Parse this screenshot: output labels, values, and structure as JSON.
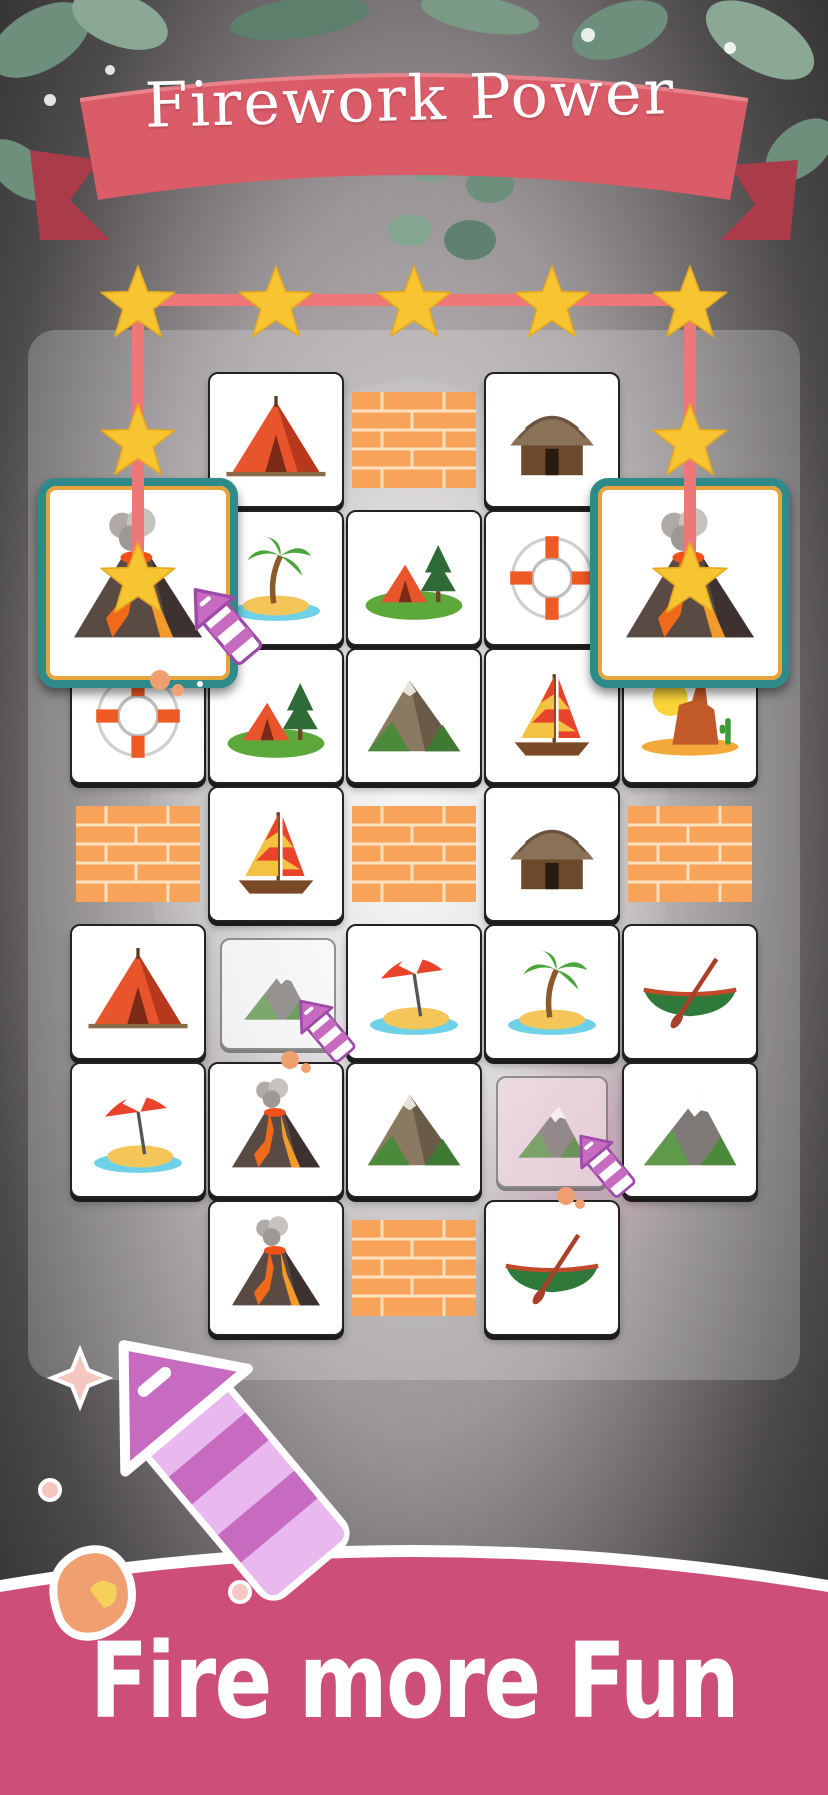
{
  "title": "Firework Power",
  "tagline": "Fire more Fun",
  "colors": {
    "banner": "#d95c68",
    "banner_dark": "#a93c48",
    "path_line": "#ee7777",
    "star": "#f7c531",
    "bottom_band": "#cd4f78",
    "rocket_pink": "#c66bbf",
    "rocket_light": "#e8b8ee"
  },
  "board": {
    "highlighted_pair": [
      "volcano",
      "volcano"
    ],
    "star_path_count": 9,
    "tiles": [
      {
        "row": 1,
        "col": 2,
        "icon": "tent-icon"
      },
      {
        "row": 1,
        "col": 3,
        "icon": "brick-icon"
      },
      {
        "row": 1,
        "col": 4,
        "icon": "hut-icon"
      },
      {
        "row": 2,
        "col": 2,
        "icon": "palm-island-icon"
      },
      {
        "row": 2,
        "col": 3,
        "icon": "camping-icon"
      },
      {
        "row": 2,
        "col": 4,
        "icon": "lifebuoy-icon"
      },
      {
        "row": 3,
        "col": 1,
        "icon": "lifebuoy-icon"
      },
      {
        "row": 3,
        "col": 2,
        "icon": "camping-icon"
      },
      {
        "row": 3,
        "col": 3,
        "icon": "mountain-icon"
      },
      {
        "row": 3,
        "col": 4,
        "icon": "sailboat-icon"
      },
      {
        "row": 3,
        "col": 5,
        "icon": "desert-icon"
      },
      {
        "row": 4,
        "col": 1,
        "icon": "brick-icon"
      },
      {
        "row": 4,
        "col": 2,
        "icon": "sailboat-icon"
      },
      {
        "row": 4,
        "col": 3,
        "icon": "brick-icon"
      },
      {
        "row": 4,
        "col": 4,
        "icon": "hut-icon"
      },
      {
        "row": 4,
        "col": 5,
        "icon": "brick-icon"
      },
      {
        "row": 5,
        "col": 1,
        "icon": "tent-icon"
      },
      {
        "row": 5,
        "col": 2,
        "icon": "snow-mountain-icon"
      },
      {
        "row": 5,
        "col": 3,
        "icon": "beach-umbrella-icon"
      },
      {
        "row": 5,
        "col": 4,
        "icon": "palm-island-icon"
      },
      {
        "row": 5,
        "col": 5,
        "icon": "canoe-icon"
      },
      {
        "row": 6,
        "col": 1,
        "icon": "beach-umbrella-icon"
      },
      {
        "row": 6,
        "col": 2,
        "icon": "volcano-icon"
      },
      {
        "row": 6,
        "col": 3,
        "icon": "mountain-icon"
      },
      {
        "row": 6,
        "col": 4,
        "icon": "snow-mountain-icon"
      },
      {
        "row": 6,
        "col": 5,
        "icon": "snow-mountain-icon"
      },
      {
        "row": 7,
        "col": 2,
        "icon": "volcano-icon"
      },
      {
        "row": 7,
        "col": 3,
        "icon": "brick-icon"
      },
      {
        "row": 7,
        "col": 4,
        "icon": "canoe-icon"
      }
    ]
  }
}
